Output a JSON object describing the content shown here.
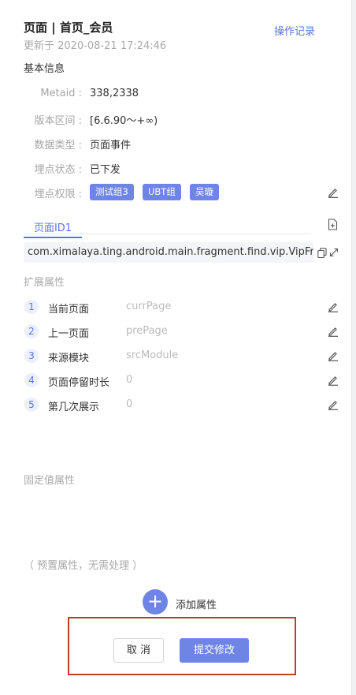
{
  "header": {
    "title": "页面 | 首页_会员",
    "op_log": "操作记录",
    "updated_at": "更新于 2020-08-21 17:24:46"
  },
  "basic": {
    "section_title": "基本信息",
    "rows": [
      {
        "label": "Metaid :",
        "value": "338,2338"
      },
      {
        "label": "版本区间 :",
        "value": "[6.6.90～+∞)"
      },
      {
        "label": "数据类型 :",
        "value": "页面事件"
      },
      {
        "label": "埋点状态 :",
        "value": "已下发"
      },
      {
        "label": "埋点权限 :",
        "value": ""
      }
    ],
    "tags": [
      "测试组3",
      "UBT组",
      "吴璇"
    ]
  },
  "page_tab": {
    "label": "页面ID1",
    "path": "com.ximalaya.ting.android.main.fragment.find.vip.VipFragment"
  },
  "extended": {
    "section_title": "扩展属性",
    "items": [
      {
        "index": "1",
        "name": "当前页面",
        "key": "currPage"
      },
      {
        "index": "2",
        "name": "上一页面",
        "key": "prePage"
      },
      {
        "index": "3",
        "name": "来源模块",
        "key": "srcModule"
      },
      {
        "index": "4",
        "name": "页面停留时长",
        "key": "0"
      },
      {
        "index": "5",
        "name": "第几次展示",
        "key": "0"
      }
    ]
  },
  "fixed": {
    "section_title": "固定值属性",
    "preset_note": "（ 预置属性，无需处理 ）"
  },
  "actions": {
    "add_label": "添加属性",
    "add_symbol": "+",
    "cancel": "取 消",
    "submit": "提交修改"
  },
  "colors": {
    "accent": "#6f85e6",
    "highlight_box": "#c23b2e"
  }
}
